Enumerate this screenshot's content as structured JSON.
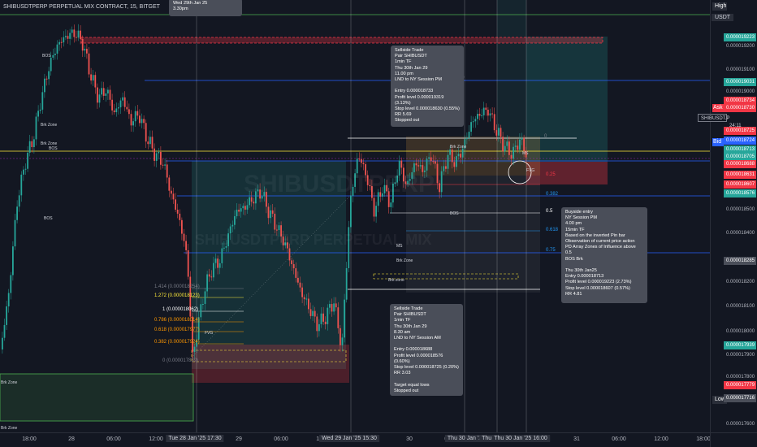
{
  "symbol": {
    "title": "SHIBUSDTPERP PERPETUAL MIX CONTRACT, 15, BITGET",
    "currency": "USDT",
    "watermark_1": "SHIBUSDTPERP",
    "watermark_2": "SHIBUSDTPERP PERPETUAL MIX"
  },
  "price_axis": {
    "ticks": [
      "0.000019223",
      "0.000019200",
      "0.000019100",
      "0.000019031",
      "0.000019000",
      "0.000018734",
      "0.000018730",
      "0.000018725",
      "0.000018724",
      "0.000018713",
      "0.000018705",
      "0.000018688",
      "0.000018631",
      "0.000018607",
      "0.000018576",
      "0.000018500",
      "0.000018400",
      "0.000018285",
      "0.000018200",
      "0.000018100",
      "0.000018000",
      "0.000017939",
      "0.000017900",
      "0.000017800",
      "0.000017779",
      "0.000017716",
      "0.000017600"
    ],
    "high_label": "High",
    "low_label": "Low",
    "ask_label": "Ask",
    "bid_label": "Bid",
    "symbol_tag": "SHIBUSDT.P",
    "countdown": "24:11"
  },
  "time_axis": {
    "ticks": [
      "18:00",
      "28",
      "06:00",
      "12:00",
      "29",
      "06:00",
      "12:00",
      "30",
      "06:00",
      "31",
      "06:00",
      "12:00",
      "18:00"
    ],
    "highlights": [
      "Tue 28 Jan '25   17:30",
      "Wed 29 Jan '25   15:30",
      "Thu 30 Jan '2",
      "Thu 30",
      "Thu 30 Jan '25   16:00"
    ]
  },
  "notes": {
    "top": "Wed 29th Jan 25\n3.30pm",
    "sellside_pm": "Sellside Trade\nPair SHIBUSDT\n1min TF\nThu 30th Jan 29\n11.00 pm\nLND to NY Session PM\n\nEntry 0.000018733\nProfit level 0.000019319 (3.13%)\nStop level 0.000018630 (0.55%)\nRR 5.69\nStopped out",
    "buyside": "Buyside entry\nNY Session PM\n4.00 pm\n15min TF\nBased on the inverted Pin bar\nObservation of current price action\nPD Array Zones of Influence above 0.5\nBOS Brk\n\nThu 30th Jan25\nEntry 0.000018713\nProfit level 0.000019223 (2.73%)\nStop level 0.000018607 (0.57%)\nRR 4.81",
    "sellside_am": "Sellside Trade\nPair SHIBUSDT\n1min TF\nThu 30th Jan 29\n8.30 am\nLND to NY Session AM\n\nEntry 0.000018688\nProfit level 0.000018576 (0.60%)\nStop level 0.000018725 (0.20%)\nRR 3.03\n\nTarget equal lows\nStopped out"
  },
  "fib_left": {
    "levels": [
      "1.414 (0.000018254)",
      "1.272 (0.000018123)",
      "1 (0.000018062)",
      "0.786 (0.000018014)",
      "0.618 (0.000017977)",
      "0.382 (0.000017924)",
      "0 (0.000017839)"
    ],
    "colors": [
      "#787b86",
      "#ffeb3b",
      "#ffffff",
      "#ff9800",
      "#ff9800",
      "#ff9800",
      "#787b86"
    ]
  },
  "fib_right": {
    "levels": [
      "0",
      "0.25",
      "0.382",
      "0.5",
      "0.618",
      "0.75"
    ],
    "colors": [
      "#787b86",
      "#f23645",
      "#2196f3",
      "#ffffff",
      "#2196f3",
      "#2196f3"
    ]
  },
  "chart_labels": {
    "bos": "BOS",
    "brk_zone": "Brk Zone",
    "brk_zone_lower": "Brk zone",
    "fvg": "FVG",
    "ms": "MS",
    "ms_tf": "MS\nTF1"
  },
  "colors": {
    "bull": "#26a69a",
    "bear": "#ef5350",
    "ask": "#f23645",
    "bid": "#2962ff",
    "green_tag": "#26a69a",
    "red_tag": "#f23645",
    "blue_line": "#2962ff",
    "yellow_line": "#ffeb3b"
  }
}
